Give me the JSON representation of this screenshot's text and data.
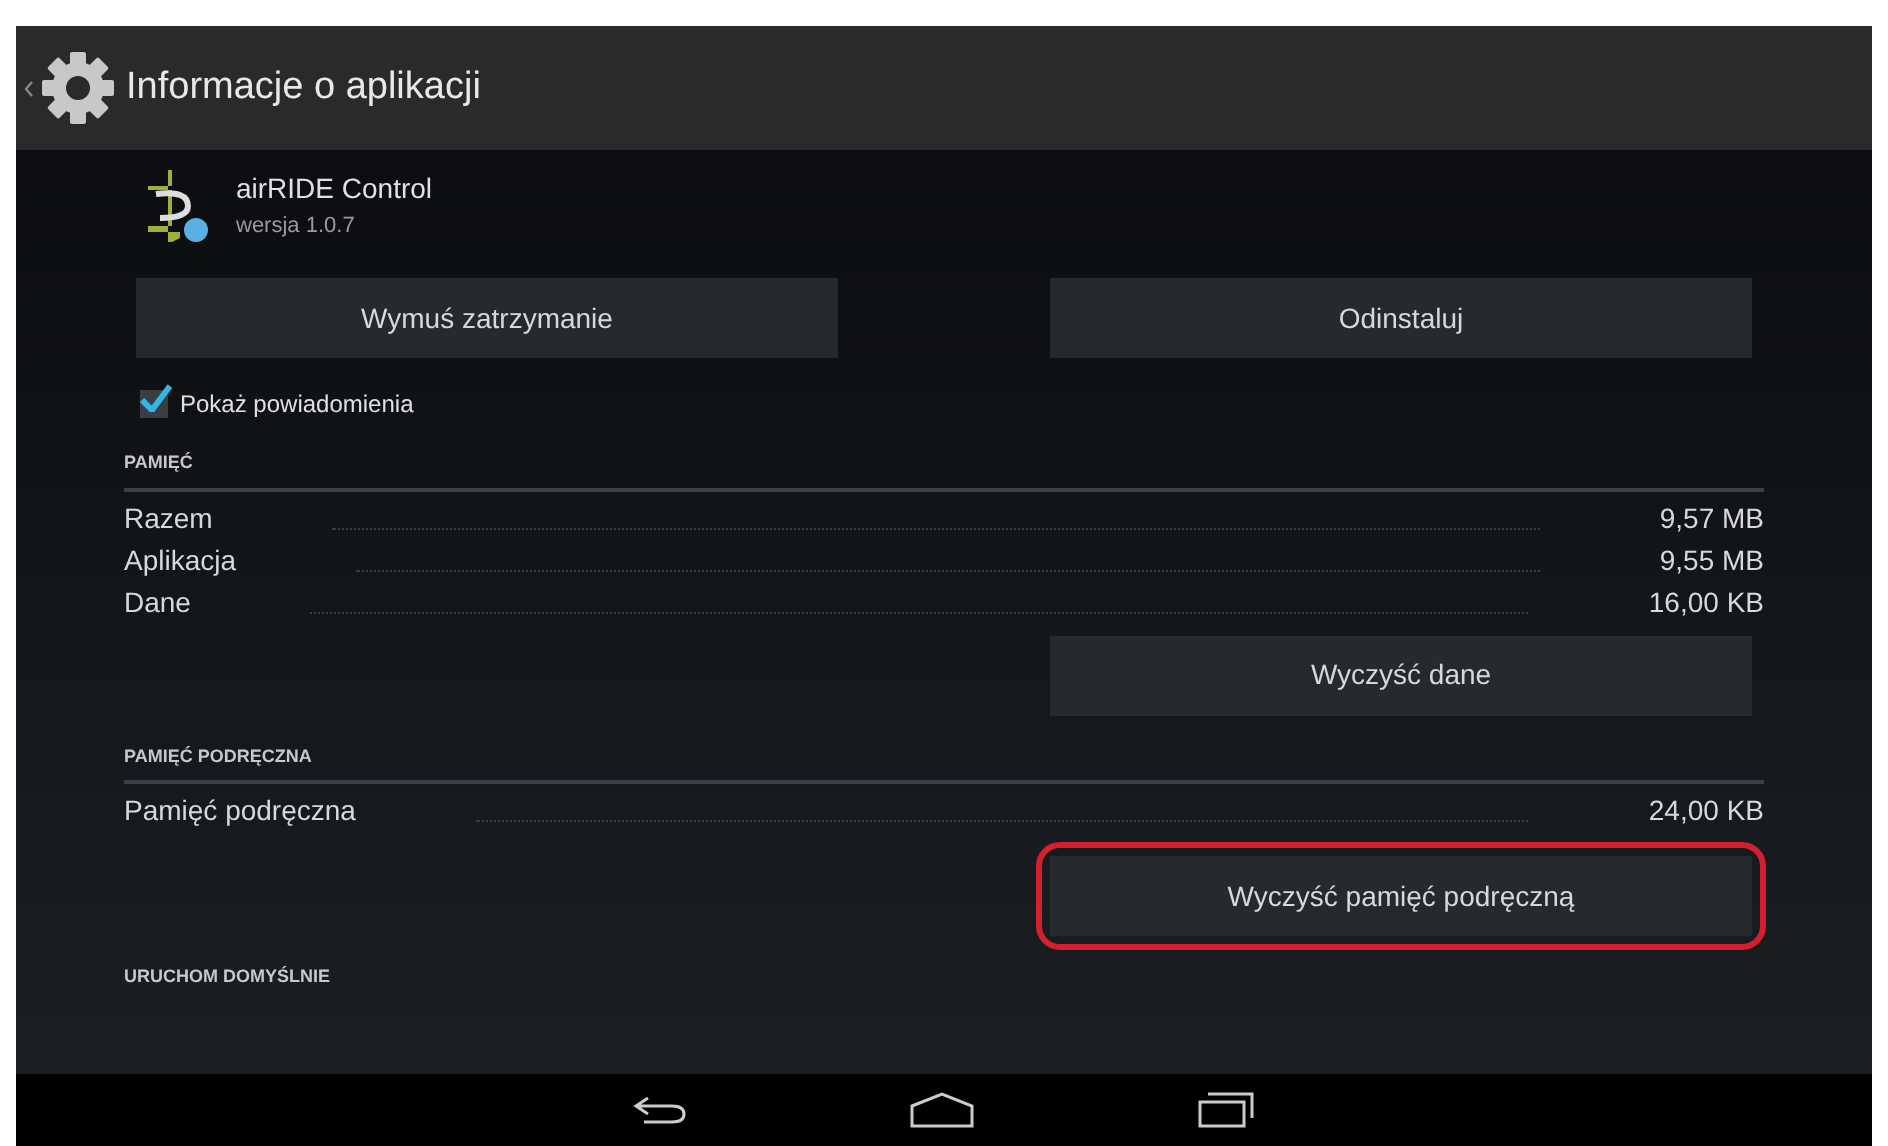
{
  "action_bar": {
    "title": "Informacje o aplikacji"
  },
  "app": {
    "name": "airRIDE Control",
    "version": "wersja 1.0.7"
  },
  "top_buttons": [
    "Wymuś zatrzymanie",
    "Odinstaluj"
  ],
  "notifications": {
    "label": "Pokaż powiadomienia",
    "checked": true
  },
  "sections": [
    {
      "header": "PAMIĘĆ",
      "rows": [
        {
          "label": "Razem",
          "value": "9,57 MB"
        },
        {
          "label": "Aplikacja",
          "value": "9,55 MB"
        },
        {
          "label": "Dane",
          "value": "16,00 KB"
        }
      ],
      "button": {
        "label": "Wyczyść dane",
        "highlighted": false
      }
    },
    {
      "header": "PAMIĘĆ PODRĘCZNA",
      "rows": [
        {
          "label": "Pamięć podręczna",
          "value": "24,00 KB"
        }
      ],
      "button": {
        "label": "Wyczyść pamięć podręczną",
        "highlighted": true
      }
    },
    {
      "header": "URUCHOM DOMYŚLNIE"
    }
  ]
}
